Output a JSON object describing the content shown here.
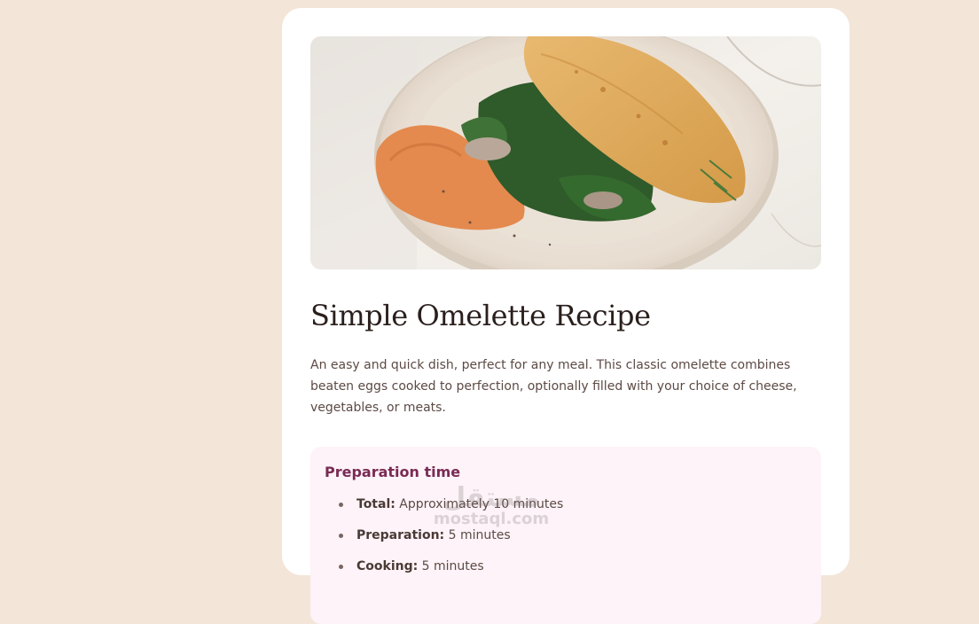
{
  "recipe": {
    "title": "Simple Omelette Recipe",
    "description": "An easy and quick dish, perfect for any meal. This classic omelette combines beaten eggs cooked to perfection, optionally filled with your choice of cheese, vegetables, or meats.",
    "image_icon": "omelette-photo"
  },
  "preparation": {
    "heading": "Preparation time",
    "items": [
      {
        "label": "Total:",
        "value": " Approximately 10 minutes"
      },
      {
        "label": "Preparation:",
        "value": " 5 minutes"
      },
      {
        "label": "Cooking:",
        "value": " 5 minutes"
      }
    ]
  },
  "watermark": {
    "arabic": "مستقل",
    "latin": "mostaql.com"
  },
  "colors": {
    "page_background": "#f3e5d8",
    "card_background": "#ffffff",
    "prep_background": "#fdf3f8",
    "prep_heading": "#7a2a54",
    "title": "#2a1f1c"
  }
}
